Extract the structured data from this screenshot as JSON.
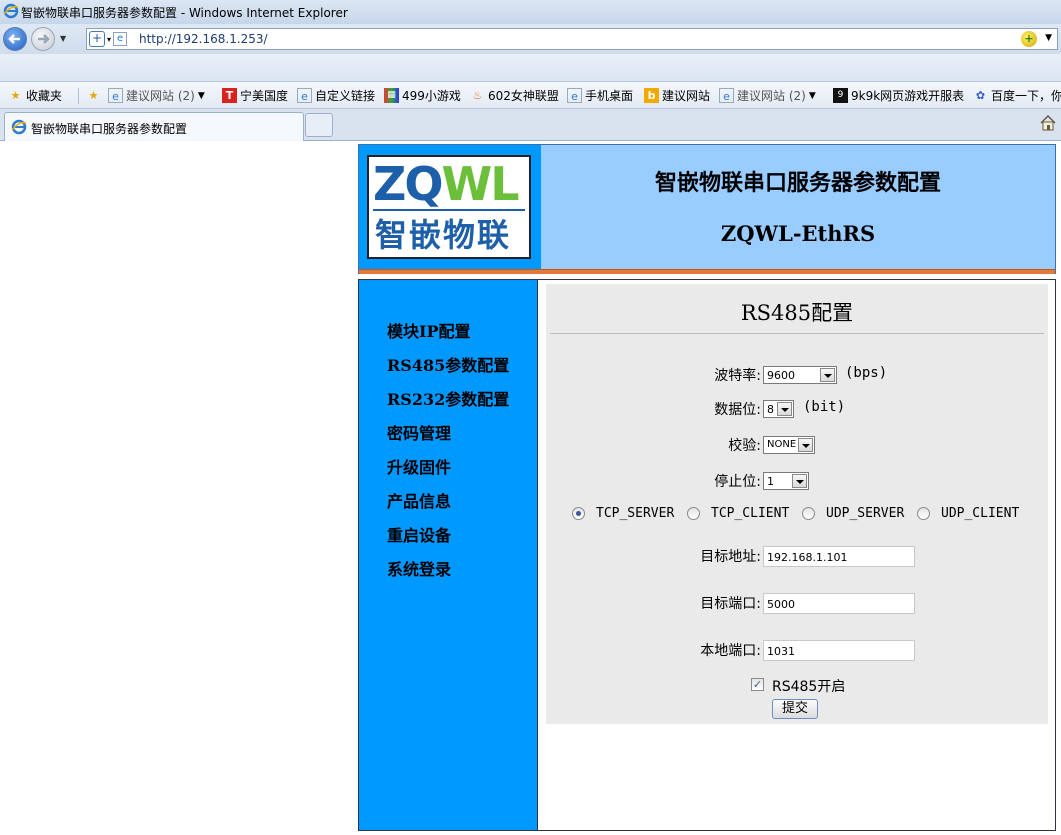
{
  "window": {
    "title": "智嵌物联串口服务器参数配置 - Windows Internet Explorer"
  },
  "address_bar": {
    "url": "http://192.168.1.253/"
  },
  "favorites": [
    {
      "label": "收藏夹",
      "icon": "star-icon"
    },
    {
      "label": "建议网站 (2)",
      "icon": "ie-page-icon",
      "dropdown": true
    },
    {
      "label": "宁美国度",
      "icon": "t-brand-icon"
    },
    {
      "label": "自定义链接",
      "icon": "ie-page-icon"
    },
    {
      "label": "499小游戏",
      "icon": "game-icon"
    },
    {
      "label": "602女神联盟",
      "icon": "flame-icon"
    },
    {
      "label": "手机桌面",
      "icon": "ie-page-icon"
    },
    {
      "label": "建议网站",
      "icon": "bing-icon"
    },
    {
      "label": "建议网站 (2)",
      "icon": "ie-page-icon",
      "dropdown": true
    },
    {
      "label": "9k9k网页游戏开服表",
      "icon": "9k-icon"
    },
    {
      "label": "百度一下，你",
      "icon": "baidu-paw-icon"
    }
  ],
  "tab": {
    "label": "智嵌物联串口服务器参数配置"
  },
  "header": {
    "logo_en_blue": "ZQ",
    "logo_en_green": "WL",
    "logo_cn": "智嵌物联",
    "title": "智嵌物联串口服务器参数配置",
    "subtitle": "ZQWL-EthRS"
  },
  "sidebar": {
    "items": [
      {
        "label": "模块IP配置"
      },
      {
        "label": "RS485参数配置"
      },
      {
        "label": "RS232参数配置"
      },
      {
        "label": "密码管理"
      },
      {
        "label": "升级固件"
      },
      {
        "label": "产品信息"
      },
      {
        "label": "重启设备"
      },
      {
        "label": "系统登录"
      }
    ]
  },
  "form": {
    "title": "RS485配置",
    "baud_label": "波特率:",
    "baud_value": "9600",
    "baud_unit": "(bps)",
    "databits_label": "数据位:",
    "databits_value": "8",
    "databits_unit": "(bit)",
    "parity_label": "校验:",
    "parity_value": "NONE",
    "stopbits_label": "停止位:",
    "stopbits_value": "1",
    "modes": [
      {
        "label": "TCP_SERVER",
        "checked": true
      },
      {
        "label": "TCP_CLIENT",
        "checked": false
      },
      {
        "label": "UDP_SERVER",
        "checked": false
      },
      {
        "label": "UDP_CLIENT",
        "checked": false
      }
    ],
    "target_addr_label": "目标地址:",
    "target_addr_value": "192.168.1.101",
    "target_port_label": "目标端口:",
    "target_port_value": "5000",
    "local_port_label": "本地端口:",
    "local_port_value": "1031",
    "enable_label": "RS485开启",
    "enable_checked": true,
    "submit_label": "提交"
  },
  "colors": {
    "sidebar_bg": "#0099ff",
    "header_bg": "#99ccff",
    "header_rule": "#e07b39",
    "form_bg": "#eaeaea"
  }
}
